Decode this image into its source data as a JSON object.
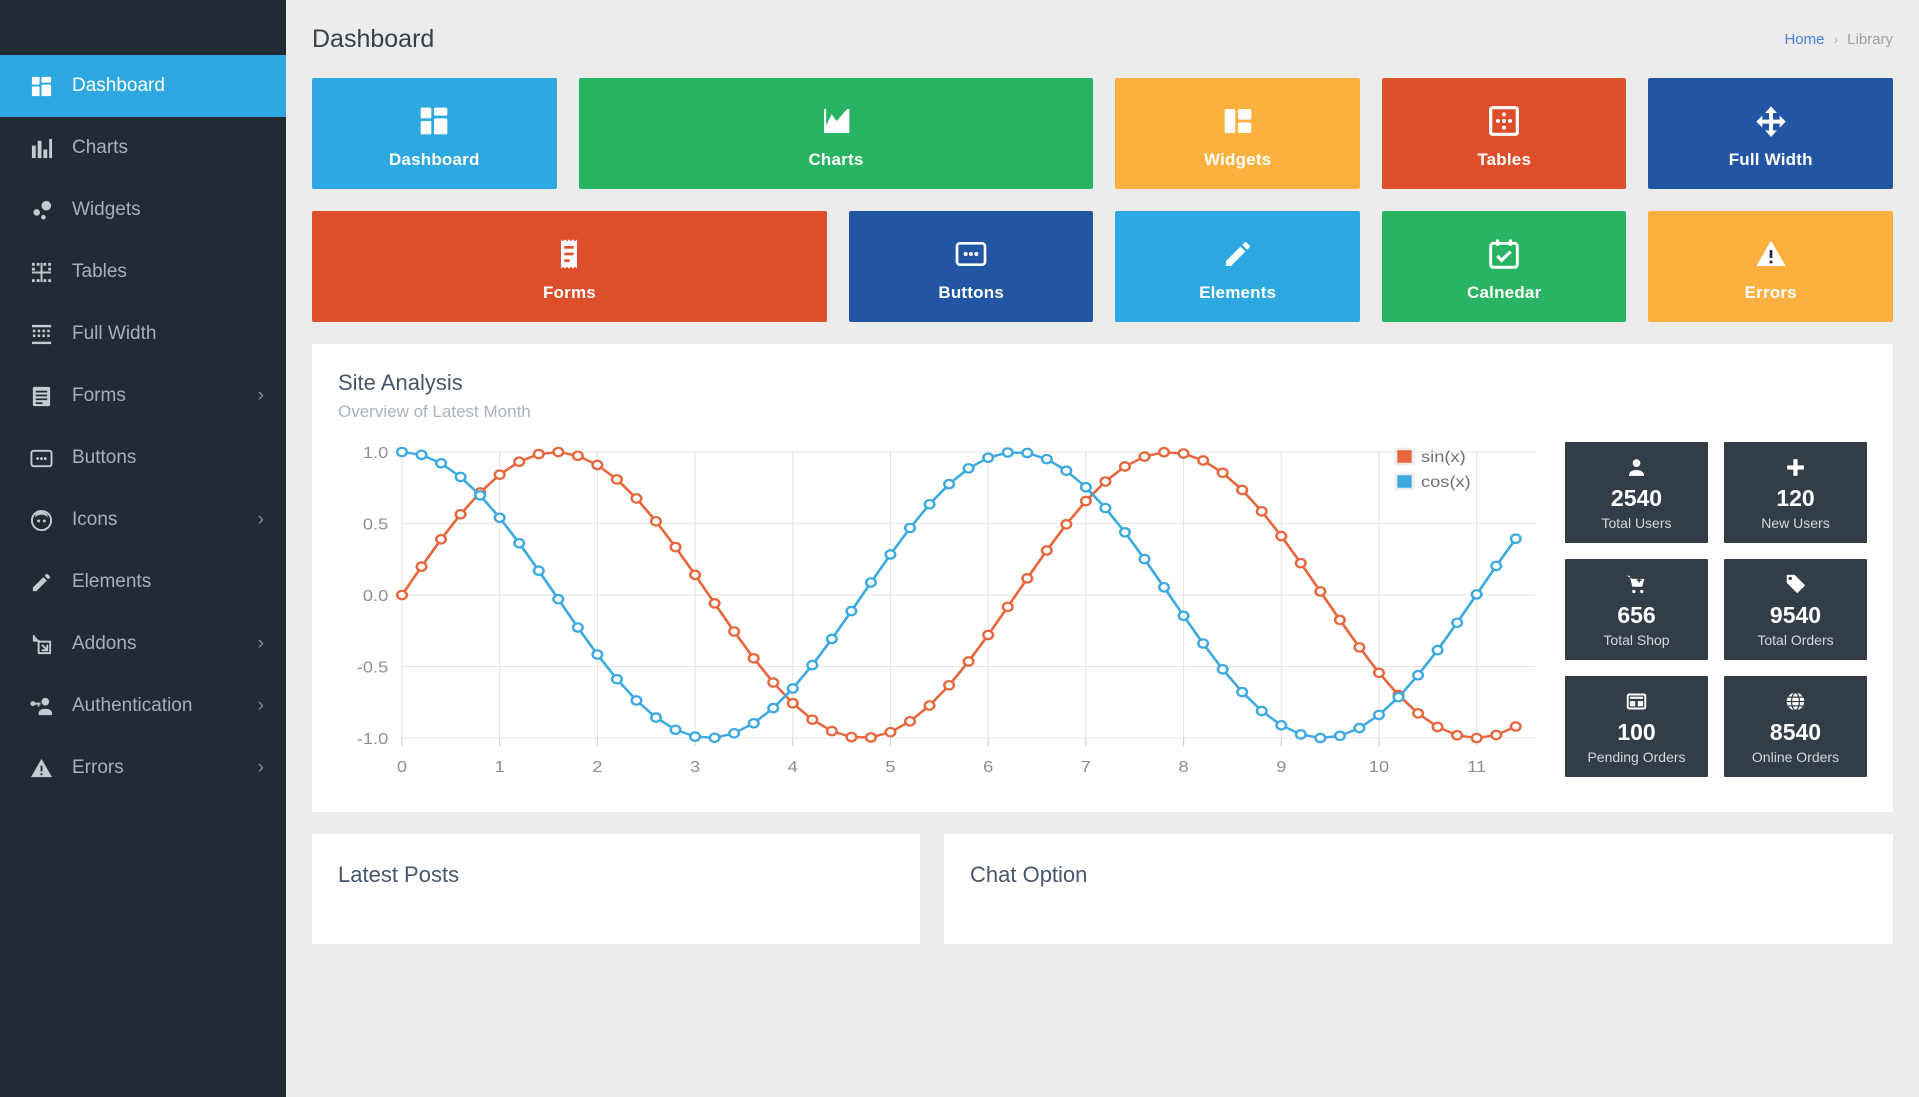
{
  "sidebar": {
    "items": [
      {
        "label": "Dashboard",
        "icon": "dashboard-icon",
        "active": true,
        "caret": false
      },
      {
        "label": "Charts",
        "icon": "bar-chart-icon",
        "active": false,
        "caret": false
      },
      {
        "label": "Widgets",
        "icon": "widgets-dots-icon",
        "active": false,
        "caret": false
      },
      {
        "label": "Tables",
        "icon": "table-grid-icon",
        "active": false,
        "caret": false
      },
      {
        "label": "Full Width",
        "icon": "full-width-icon",
        "active": false,
        "caret": false
      },
      {
        "label": "Forms",
        "icon": "forms-icon",
        "active": false,
        "caret": true
      },
      {
        "label": "Buttons",
        "icon": "buttons-icon",
        "active": false,
        "caret": false
      },
      {
        "label": "Icons",
        "icon": "smiley-face-icon",
        "active": false,
        "caret": true
      },
      {
        "label": "Elements",
        "icon": "pencil-icon",
        "active": false,
        "caret": false
      },
      {
        "label": "Addons",
        "icon": "addons-resize-icon",
        "active": false,
        "caret": true
      },
      {
        "label": "Authentication",
        "icon": "key-user-icon",
        "active": false,
        "caret": true
      },
      {
        "label": "Errors",
        "icon": "warning-triangle-icon",
        "active": false,
        "caret": true
      }
    ],
    "caret_glyph": "›"
  },
  "header": {
    "title": "Dashboard",
    "breadcrumb": {
      "home": "Home",
      "separator": "›",
      "current": "Library"
    }
  },
  "tiles": {
    "row1": [
      {
        "label": "Dashboard",
        "icon": "dashboard-icon",
        "color": "#2ea8e0",
        "flex": 189
      },
      {
        "label": "Charts",
        "icon": "line-chart-icon",
        "color": "#28b463",
        "flex": 398
      },
      {
        "label": "Widgets",
        "icon": "widgets-icon",
        "color": "#fbb040",
        "flex": 189
      },
      {
        "label": "Tables",
        "icon": "table-dots-icon",
        "color": "#dd4f2b",
        "flex": 189
      },
      {
        "label": "Full Width",
        "icon": "arrows-move-icon",
        "color": "#2255a4",
        "flex": 189
      }
    ],
    "row2": [
      {
        "label": "Forms",
        "icon": "receipt-icon",
        "color": "#dd4f2b",
        "flex": 398
      },
      {
        "label": "Buttons",
        "icon": "buttons-icon",
        "color": "#2255a4",
        "flex": 189
      },
      {
        "label": "Elements",
        "icon": "pencil-icon",
        "color": "#2ea8e0",
        "flex": 189
      },
      {
        "label": "Calnedar",
        "icon": "calendar-check-icon",
        "color": "#28b463",
        "flex": 189
      },
      {
        "label": "Errors",
        "icon": "warning-triangle-icon",
        "color": "#fbb040",
        "flex": 189
      }
    ]
  },
  "site_analysis": {
    "title": "Site Analysis",
    "subtitle": "Overview of Latest Month"
  },
  "chart_data": {
    "type": "line",
    "title": "Site Analysis",
    "subtitle": "Overview of Latest Month",
    "xlabel": "",
    "ylabel": "",
    "xlim": [
      0,
      11.6
    ],
    "ylim": [
      -1.0,
      1.0
    ],
    "xticks": [
      "0",
      "1",
      "2",
      "3",
      "4",
      "5",
      "6",
      "7",
      "8",
      "9",
      "10",
      "11"
    ],
    "xtick_values": [
      0,
      1,
      2,
      3,
      4,
      5,
      6,
      7,
      8,
      9,
      10,
      11
    ],
    "yticks": [
      "1.0",
      "0.5",
      "0.0",
      "-0.5",
      "-1.0"
    ],
    "ytick_values": [
      1.0,
      0.5,
      0.0,
      -0.5,
      -1.0
    ],
    "grid": true,
    "legend": [
      "sin(x)",
      "cos(x)"
    ],
    "legend_position": "top-right",
    "marker": "open-circle",
    "x_step": 0.2,
    "n_points": 59,
    "series": [
      {
        "name": "sin(x)",
        "color": "#e8663c",
        "fn": "sin"
      },
      {
        "name": "cos(x)",
        "color": "#3ca9e0",
        "fn": "cos"
      }
    ]
  },
  "stats": [
    {
      "value": "2540",
      "label": "Total Users",
      "icon": "user-icon"
    },
    {
      "value": "120",
      "label": "New Users",
      "icon": "plus-icon"
    },
    {
      "value": "656",
      "label": "Total Shop",
      "icon": "cart-plus-icon"
    },
    {
      "value": "9540",
      "label": "Total Orders",
      "icon": "tag-icon"
    },
    {
      "value": "100",
      "label": "Pending Orders",
      "icon": "grid-table-icon"
    },
    {
      "value": "8540",
      "label": "Online Orders",
      "icon": "globe-icon"
    }
  ],
  "bottom": {
    "latest_posts_title": "Latest Posts",
    "chat_option_title": "Chat Option"
  }
}
